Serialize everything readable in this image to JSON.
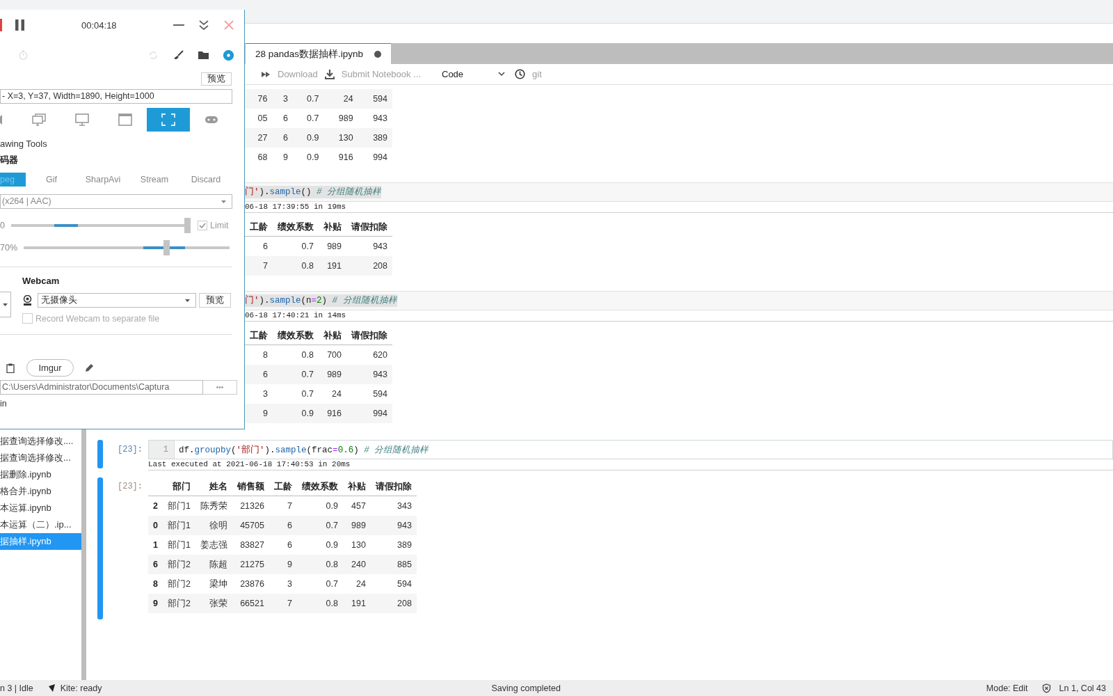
{
  "notebook_tab": {
    "title": "28 pandas数据抽样.ipynb",
    "unsaved": true
  },
  "toolbar": {
    "download": "Download",
    "submit": "Submit Notebook ...",
    "cell_type": "Code",
    "git": "git"
  },
  "file_browser": {
    "items": [
      {
        "name": "据查询选择修改....",
        "selected": false
      },
      {
        "name": "据查询选择修改...",
        "selected": false
      },
      {
        "name": "据删除.ipynb",
        "selected": false
      },
      {
        "name": "格合并.ipynb",
        "selected": false
      },
      {
        "name": "本运算.ipynb",
        "selected": false
      },
      {
        "name": "本运算（二）.ip...",
        "selected": false
      },
      {
        "name": "据抽样.ipynb",
        "selected": true
      }
    ]
  },
  "cells": [
    {
      "output": {
        "rows": [
          [
            "76",
            "3",
            "0.7",
            "24",
            "594"
          ],
          [
            "05",
            "6",
            "0.7",
            "989",
            "943"
          ],
          [
            "27",
            "6",
            "0.9",
            "130",
            "389"
          ],
          [
            "68",
            "9",
            "0.9",
            "916",
            "994"
          ]
        ]
      }
    },
    {
      "input": {
        "highlighted": true,
        "tokens": [
          {
            "text": "门'",
            "kind": "string"
          },
          {
            "text": ").",
            "kind": "plain"
          },
          {
            "text": "sample",
            "kind": "attr"
          },
          {
            "text": "() ",
            "kind": "plain"
          },
          {
            "text": "# 分组随机抽样",
            "kind": "comment"
          }
        ]
      },
      "executed": "06-18 17:39:55 in 19ms",
      "output": {
        "columns": [
          "工龄",
          "绩效系数",
          "补贴",
          "请假扣除"
        ],
        "rows": [
          [
            "6",
            "0.7",
            "989",
            "943"
          ],
          [
            "7",
            "0.8",
            "191",
            "208"
          ]
        ]
      }
    },
    {
      "input": {
        "highlighted": true,
        "tokens": [
          {
            "text": "门'",
            "kind": "string"
          },
          {
            "text": ").",
            "kind": "plain"
          },
          {
            "text": "sample",
            "kind": "attr"
          },
          {
            "text": "(n",
            "kind": "plain"
          },
          {
            "text": "=",
            "kind": "op"
          },
          {
            "text": "2",
            "kind": "number"
          },
          {
            "text": ") ",
            "kind": "plain"
          },
          {
            "text": "# 分组随机抽样",
            "kind": "comment"
          }
        ]
      },
      "executed": "06-18 17:40:21 in 14ms",
      "output": {
        "columns": [
          "工龄",
          "绩效系数",
          "补贴",
          "请假扣除"
        ],
        "rows": [
          [
            "8",
            "0.8",
            "700",
            "620"
          ],
          [
            "6",
            "0.7",
            "989",
            "943"
          ],
          [
            "3",
            "0.7",
            "24",
            "594"
          ],
          [
            "9",
            "0.9",
            "916",
            "994"
          ]
        ]
      }
    },
    {
      "prompt": "[23]:",
      "line_number": "1",
      "input": {
        "highlighted": false,
        "tokens": [
          {
            "text": "df.",
            "kind": "plain"
          },
          {
            "text": "groupby",
            "kind": "attr"
          },
          {
            "text": "(",
            "kind": "plain"
          },
          {
            "text": "'部门'",
            "kind": "string"
          },
          {
            "text": ").",
            "kind": "plain"
          },
          {
            "text": "sample",
            "kind": "attr"
          },
          {
            "text": "(frac",
            "kind": "plain"
          },
          {
            "text": "=",
            "kind": "op"
          },
          {
            "text": "0.6",
            "kind": "number"
          },
          {
            "text": ") ",
            "kind": "plain"
          },
          {
            "text": "# 分组随机抽样",
            "kind": "comment"
          }
        ]
      },
      "executed": "Last executed at 2021-06-18 17:40:53 in 20ms",
      "output_prompt": "[23]:",
      "output": {
        "columns": [
          "",
          "部门",
          "姓名",
          "销售额",
          "工龄",
          "绩效系数",
          "补贴",
          "请假扣除"
        ],
        "rows": [
          [
            "2",
            "部门1",
            "陈秀荣",
            "21326",
            "7",
            "0.9",
            "457",
            "343"
          ],
          [
            "0",
            "部门1",
            "徐明",
            "45705",
            "6",
            "0.7",
            "989",
            "943"
          ],
          [
            "1",
            "部门1",
            "姜志强",
            "83827",
            "6",
            "0.9",
            "130",
            "389"
          ],
          [
            "6",
            "部门2",
            "陈超",
            "21275",
            "9",
            "0.8",
            "240",
            "885"
          ],
          [
            "8",
            "部门2",
            "梁坤",
            "23876",
            "3",
            "0.7",
            "24",
            "594"
          ],
          [
            "9",
            "部门2",
            "张荣",
            "66521",
            "7",
            "0.8",
            "191",
            "208"
          ]
        ]
      }
    }
  ],
  "status_bar": {
    "kernel": "n 3 | Idle",
    "kite": "Kite: ready",
    "message": "Saving completed",
    "mode": "Mode: Edit",
    "position": "Ln 1, Col 43"
  },
  "recorder": {
    "timer": "00:04:18",
    "preview": "预览",
    "region": "- X=3, Y=37, Width=1890, Height=1000",
    "sources": [
      {
        "kind": "speaker",
        "selected": false
      },
      {
        "kind": "screens",
        "selected": false
      },
      {
        "kind": "screen",
        "selected": false
      },
      {
        "kind": "window",
        "selected": false
      },
      {
        "kind": "region",
        "selected": true
      },
      {
        "kind": "gamepad",
        "selected": false
      }
    ],
    "drawing_tools": "awing Tools",
    "encoder_heading": "码器",
    "encoders": [
      {
        "label": "peg",
        "selected": true
      },
      {
        "label": "Gif",
        "selected": false
      },
      {
        "label": "SharpAvi",
        "selected": false
      },
      {
        "label": "Stream",
        "selected": false
      },
      {
        "label": "Discard",
        "selected": false
      }
    ],
    "codec": "(x264 | AAC)",
    "frame_rate": {
      "label": "0",
      "level": 1,
      "limit": {
        "label": "Limit",
        "checked": true
      }
    },
    "quality": {
      "label": "70%",
      "level": 0.7
    },
    "webcam": {
      "title": "Webcam",
      "device": "无摄像头",
      "preview": "预览",
      "separate_file": {
        "label": "Record Webcam to separate file",
        "checked": false
      }
    },
    "upload": "Imgur",
    "output_folder": "C:\\Users\\Administrator\\Documents\\Captura",
    "browse": "•••",
    "footer": "in"
  }
}
